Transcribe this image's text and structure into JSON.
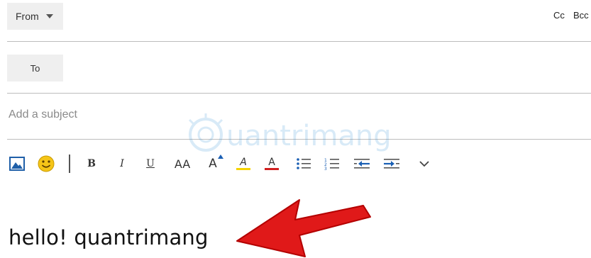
{
  "header": {
    "from_label": "From",
    "to_label": "To",
    "cc_label": "Cc",
    "bcc_label": "Bcc"
  },
  "subject": {
    "placeholder": "Add a subject",
    "value": ""
  },
  "toolbar": {
    "items": [
      {
        "name": "insert-picture-icon",
        "label": ""
      },
      {
        "name": "emoji-icon",
        "label": ""
      },
      {
        "name": "bold-button",
        "label": "B"
      },
      {
        "name": "italic-button",
        "label": "I"
      },
      {
        "name": "underline-button",
        "label": "U"
      },
      {
        "name": "font-size-button",
        "label": "AA"
      },
      {
        "name": "grow-font-button",
        "label": "A"
      },
      {
        "name": "highlight-button",
        "label": "A"
      },
      {
        "name": "font-color-button",
        "label": "A"
      },
      {
        "name": "bullets-icon",
        "label": ""
      },
      {
        "name": "numbering-icon",
        "label": ""
      },
      {
        "name": "decrease-indent-icon",
        "label": ""
      },
      {
        "name": "increase-indent-icon",
        "label": ""
      },
      {
        "name": "more-options-chevron-icon",
        "label": ""
      }
    ],
    "colors": {
      "picture": "#1f5fa8",
      "emoji": "#f5c518",
      "highlight": "#f5d300",
      "font_color": "#d11f1f",
      "indent_arrow": "#1a5fb4"
    }
  },
  "message": {
    "body": "hello! quantrimang"
  },
  "watermark": {
    "text": "Quantrimang"
  },
  "annotation": {
    "arrow_color": "#e01919"
  }
}
